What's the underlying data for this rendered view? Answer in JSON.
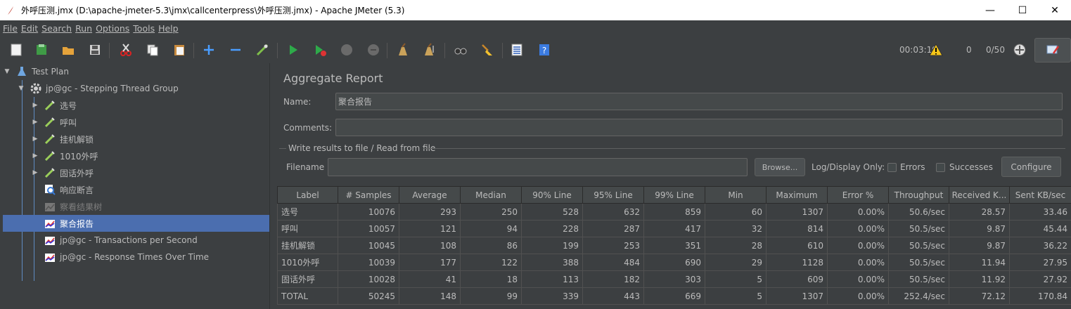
{
  "window": {
    "title": "外呼压测.jmx (D:\\apache-jmeter-5.3\\jmx\\callcenterpress\\外呼压测.jmx) - Apache JMeter (5.3)",
    "minimize": "—",
    "maximize": "☐",
    "close": "✕"
  },
  "menu": [
    "File",
    "Edit",
    "Search",
    "Run",
    "Options",
    "Tools",
    "Help"
  ],
  "status": {
    "elapsed": "00:03:19",
    "warnings": "0",
    "threads": "0/50"
  },
  "tree": {
    "nodes": [
      {
        "label": "Test Plan",
        "icon": "test-plan-icon"
      },
      {
        "label": "jp@gc - Stepping Thread Group",
        "icon": "gear-icon"
      },
      {
        "label": "选号",
        "icon": "pipette-icon"
      },
      {
        "label": "呼叫",
        "icon": "pipette-icon"
      },
      {
        "label": "挂机解锁",
        "icon": "pipette-icon"
      },
      {
        "label": "1010外呼",
        "icon": "pipette-icon"
      },
      {
        "label": "固话外呼",
        "icon": "pipette-icon"
      },
      {
        "label": "响应断言",
        "icon": "magnifier-icon"
      },
      {
        "label": "察看结果树",
        "icon": "chart-icon"
      },
      {
        "label": "聚合报告",
        "icon": "chart-icon"
      },
      {
        "label": "jp@gc - Transactions per Second",
        "icon": "chart-icon"
      },
      {
        "label": "jp@gc - Response Times Over Time",
        "icon": "chart-icon"
      }
    ]
  },
  "panel": {
    "title": "Aggregate Report",
    "name_label": "Name:",
    "name_value": "聚合报告",
    "comments_label": "Comments:",
    "comments_value": "",
    "group_title": "Write results to file / Read from file",
    "filename_label": "Filename",
    "filename_value": "",
    "browse_label": "Browse...",
    "log_display_label": "Log/Display Only:",
    "errors_label": "Errors",
    "successes_label": "Successes",
    "configure_label": "Configure"
  },
  "table": {
    "headers": [
      "Label",
      "# Samples",
      "Average",
      "Median",
      "90% Line",
      "95% Line",
      "99% Line",
      "Min",
      "Maximum",
      "Error %",
      "Throughput",
      "Received K...",
      "Sent KB/sec"
    ],
    "rows": [
      [
        "选号",
        "10076",
        "293",
        "250",
        "528",
        "632",
        "859",
        "60",
        "1307",
        "0.00%",
        "50.6/sec",
        "28.57",
        "33.46"
      ],
      [
        "呼叫",
        "10057",
        "121",
        "94",
        "228",
        "287",
        "417",
        "32",
        "814",
        "0.00%",
        "50.5/sec",
        "9.87",
        "45.44"
      ],
      [
        "挂机解锁",
        "10045",
        "108",
        "86",
        "199",
        "253",
        "351",
        "28",
        "610",
        "0.00%",
        "50.5/sec",
        "9.87",
        "36.22"
      ],
      [
        "1010外呼",
        "10039",
        "177",
        "122",
        "388",
        "484",
        "690",
        "29",
        "1128",
        "0.00%",
        "50.5/sec",
        "11.94",
        "27.95"
      ],
      [
        "固话外呼",
        "10028",
        "41",
        "18",
        "113",
        "182",
        "303",
        "5",
        "609",
        "0.00%",
        "50.5/sec",
        "11.92",
        "27.92"
      ],
      [
        "TOTAL",
        "50245",
        "148",
        "99",
        "339",
        "443",
        "669",
        "5",
        "1307",
        "0.00%",
        "252.4/sec",
        "72.12",
        "170.84"
      ]
    ]
  },
  "colors": {
    "background": "#3c3f41",
    "selection": "#4b6eaf",
    "text": "#bbbbbb"
  }
}
